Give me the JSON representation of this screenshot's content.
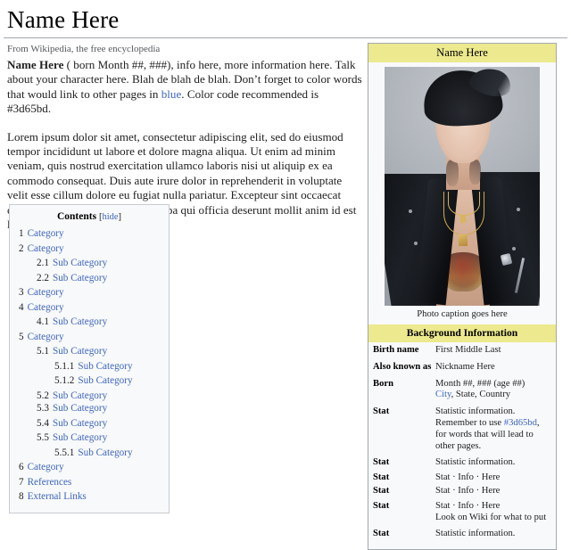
{
  "page": {
    "title": "Name Here",
    "tagline": "From Wikipedia, the free encyclopedia"
  },
  "article": {
    "lead_name": "Name Here",
    "lead_part1": " ( born Month ##, ###), info here, more information here. Talk about your character here. Blah de blah de blah. Don’t forget to color words that would link to other pages in ",
    "lead_link": "blue",
    "lead_part2": ". Color code recommended is #3d65bd.",
    "body_paragraph": "Lorem ipsum dolor sit amet, consectetur adipiscing elit, sed do eiusmod tempor incididunt ut labore et dolore magna aliqua. Ut enim ad minim veniam, quis nostrud exercitation ullamco laboris nisi ut aliquip ex ea commodo consequat. Duis aute irure dolor in reprehenderit in voluptate velit esse cillum dolore eu fugiat nulla pariatur. Excepteur sint occaecat cupidatat non proident, sunt in culpa qui officia deserunt mollit anim id est laborum."
  },
  "toc": {
    "title": "Contents",
    "toggle_open": "[",
    "toggle_label": "hide",
    "toggle_close": "]",
    "items": [
      {
        "number": "1",
        "text": "Category",
        "level": 1
      },
      {
        "number": "2",
        "text": "Category",
        "level": 1
      },
      {
        "number": "2.1",
        "text": "Sub Category",
        "level": 2
      },
      {
        "number": "2.2",
        "text": "Sub Category",
        "level": 2
      },
      {
        "number": "3",
        "text": "Category",
        "level": 1
      },
      {
        "number": "4",
        "text": "Category",
        "level": 1
      },
      {
        "number": "4.1",
        "text": "Sub Category",
        "level": 2
      },
      {
        "number": "5",
        "text": "Category",
        "level": 1
      },
      {
        "number": "5.1",
        "text": "Sub Category",
        "level": 2
      },
      {
        "number": "5.1.1",
        "text": "Sub Category",
        "level": 3
      },
      {
        "number": "5.1.2",
        "text": "Sub Category",
        "level": 3
      },
      {
        "number": "5.2",
        "text": "Sub Category",
        "level": 2,
        "tight": true
      },
      {
        "number": "5.3",
        "text": "Sub Category",
        "level": 2
      },
      {
        "number": "5.4",
        "text": "Sub Category",
        "level": 2
      },
      {
        "number": "5.5",
        "text": "Sub Category",
        "level": 2
      },
      {
        "number": "5.5.1",
        "text": "Sub Category",
        "level": 3
      },
      {
        "number": "6",
        "text": "Category",
        "level": 1
      },
      {
        "number": "7",
        "text": "References",
        "level": 1
      },
      {
        "number": "8",
        "text": "External Links",
        "level": 1
      }
    ]
  },
  "infobox": {
    "header": "Name Here",
    "caption": "Photo caption goes here",
    "section_header": "Background Information",
    "image_alt": "portrait-photo",
    "rows": [
      {
        "label": "Birth name",
        "value": "First Middle Last"
      },
      {
        "label": "Also known as",
        "value": "Nickname Here"
      },
      {
        "label": "Born",
        "value": "Month ##, ### (age ##)",
        "value_line2_link": "City",
        "value_line2_rest": ", State, Country"
      },
      {
        "label": "Stat",
        "value_pre": "Statistic information. Remember to use ",
        "value_link": "#3d65bd",
        "value_post": ", for words that will lead to other pages."
      },
      {
        "label": "Stat",
        "value": "Statistic information."
      },
      {
        "label": "Stat",
        "value": "Stat · Info · Here"
      },
      {
        "label": "Stat",
        "value": "Stat · Info · Here"
      },
      {
        "label": "Stat",
        "value": "Stat · Info · Here",
        "value_line2": "Look on Wiki for what to put"
      },
      {
        "label": "Stat",
        "value": "Statistic information."
      }
    ]
  },
  "colors": {
    "link": "#3d65bd",
    "infobox_header_bg": "#ece98e",
    "infobox_bg": "#f8f9fa",
    "infobox_border": "#a2a9b1",
    "toc_bg": "#f8f9fa",
    "toc_border": "#c8ccd1"
  }
}
